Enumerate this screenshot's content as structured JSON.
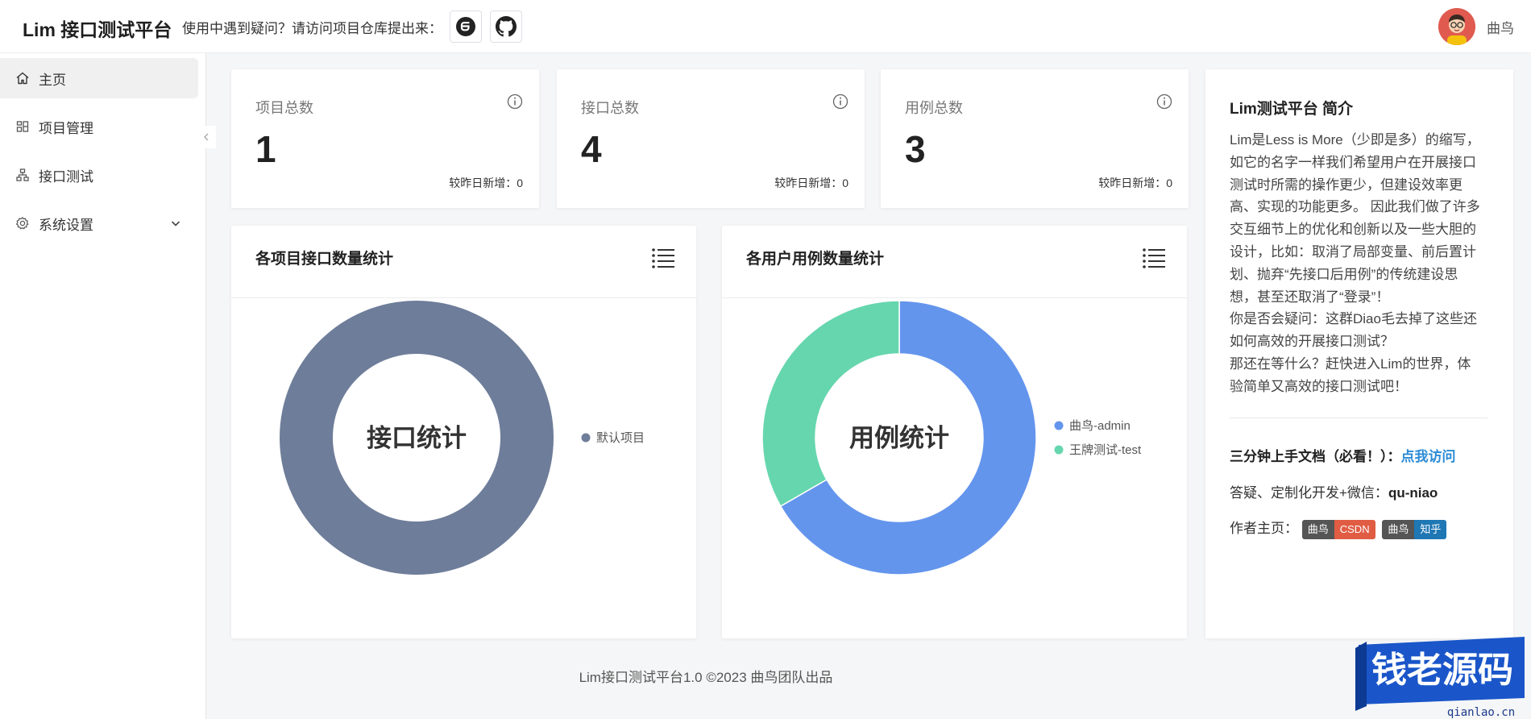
{
  "header": {
    "app_title": "Lim 接口测试平台",
    "help_text": "使用中遇到疑问？请访问项目仓库提出来：",
    "user_name": "曲鸟"
  },
  "sidebar": {
    "items": [
      {
        "label": "主页",
        "icon": "home-icon",
        "active": true
      },
      {
        "label": "项目管理",
        "icon": "grid-icon",
        "active": false
      },
      {
        "label": "接口测试",
        "icon": "sitemap-icon",
        "active": false
      },
      {
        "label": "系统设置",
        "icon": "gear-icon",
        "active": false
      }
    ]
  },
  "stats": [
    {
      "label": "项目总数",
      "value": "1",
      "delta": "较昨日新增：0"
    },
    {
      "label": "接口总数",
      "value": "4",
      "delta": "较昨日新增：0"
    },
    {
      "label": "用例总数",
      "value": "3",
      "delta": "较昨日新增：0"
    }
  ],
  "chart_cards": {
    "c1_title": "各项目接口数量统计",
    "c2_title": "各用户用例数量统计"
  },
  "chart_data": [
    {
      "type": "pie",
      "title": "各项目接口数量统计",
      "center_label": "接口统计",
      "legend_position": "right",
      "series": [
        {
          "name": "默认项目",
          "value": 4,
          "color": "#6e7d99"
        }
      ]
    },
    {
      "type": "pie",
      "title": "各用户用例数量统计",
      "center_label": "用例统计",
      "legend_position": "right",
      "series": [
        {
          "name": "曲鸟-admin",
          "value": 2,
          "color": "#6495ed"
        },
        {
          "name": "王牌测试-test",
          "value": 1,
          "color": "#66d6ae"
        }
      ]
    }
  ],
  "intro": {
    "title": "Lim测试平台 简介",
    "lines": [
      "Lim是Less is More（少即是多）的缩写，",
      "如它的名字一样我们希望用户在开展接口",
      "测试时所需的操作更少，但建设效率更",
      "高、实现的功能更多。 因此我们做了许多",
      "交互细节上的优化和创新以及一些大胆的",
      "设计，比如：取消了局部变量、前后置计",
      "划、抛弃“先接口后用例”的传统建设思",
      "想，甚至还取消了“登录”！",
      "你是否会疑问：这群Diao毛去掉了这些还",
      "如何高效的开展接口测试？",
      "那还在等什么？赶快进入Lim的世界，体",
      "验简单又高效的接口测试吧！"
    ],
    "doc_label": "三分钟上手文档（必看！）：",
    "doc_link": "点我访问",
    "contact_label": "答疑、定制化开发+微信：",
    "contact_value": "qu-niao",
    "author_label": "作者主页：",
    "badge1_left": "曲鸟",
    "badge1_right": "CSDN",
    "badge2_left": "曲鸟",
    "badge2_right": "知乎"
  },
  "footer": "Lim接口测试平台1.0 ©2023 曲鸟团队出品",
  "watermark": {
    "text": "钱老源码",
    "url": "qianlao.cn"
  }
}
